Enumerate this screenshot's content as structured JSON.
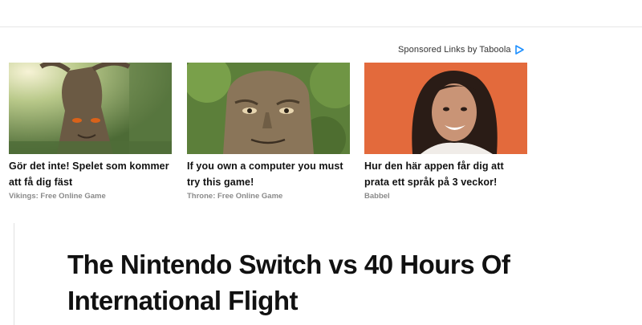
{
  "sponsor": {
    "label": "Sponsored Links by Taboola",
    "icon": "taboola-icon",
    "brand_color": "#1e90ff"
  },
  "cards": [
    {
      "headline": "Gör det inte! Spelet som kommer att få dig fäst",
      "source": "Vikings: Free Online Game",
      "image": "wise-tree-forest-image"
    },
    {
      "headline": "If you own a computer you must try this game!",
      "source": "Throne: Free Online Game",
      "image": "wise-tree-face-image"
    },
    {
      "headline": "Hur den här appen får dig att prata ett språk på 3 veckor!",
      "source": "Babbel",
      "image": "smiling-woman-image"
    }
  ],
  "article": {
    "title": "The Nintendo Switch vs 40 Hours Of International Flight"
  }
}
